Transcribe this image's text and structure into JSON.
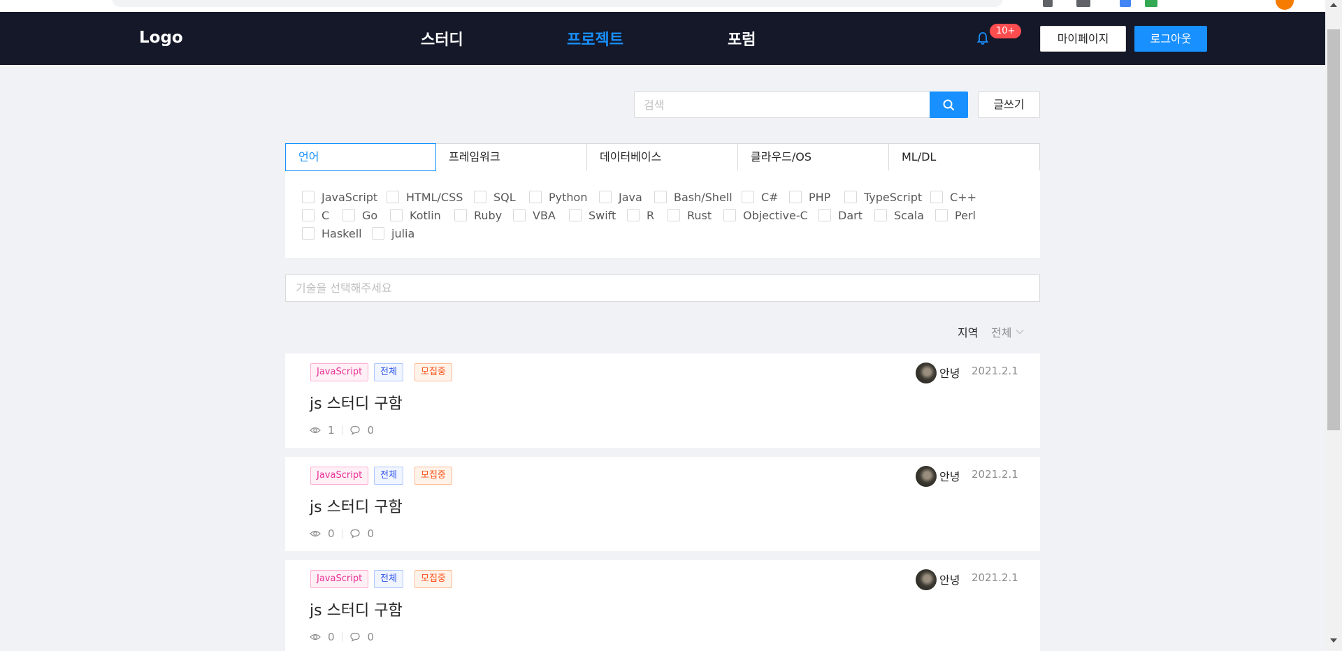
{
  "header": {
    "logo": "Logo",
    "nav": [
      "스터디",
      "프로젝트",
      "포럼"
    ],
    "active_nav": "프로젝트",
    "badge": "10+",
    "mypage_label": "마이페이지",
    "logout_label": "로그아웃"
  },
  "search": {
    "placeholder": "검색",
    "write_label": "글쓰기"
  },
  "tabs": [
    "언어",
    "프레임워크",
    "데이터베이스",
    "클라우드/OS",
    "ML/DL"
  ],
  "active_tab": "언어",
  "languages": {
    "row1": [
      "JavaScript",
      "HTML/CSS",
      "SQL",
      "Python",
      "Java",
      "Bash/Shell",
      "C#",
      "PHP",
      "TypeScript",
      "C++"
    ],
    "row2": [
      "C",
      "Go",
      "Kotlin",
      "Ruby",
      "VBA",
      "Swift",
      "R",
      "Rust",
      "Objective-C",
      "Dart",
      "Scala",
      "Perl"
    ],
    "row3": [
      "Haskell",
      "julia"
    ]
  },
  "skill_placeholder": "기술을 선택해주세요",
  "filter": {
    "region_label": "지역",
    "region_value": "전체"
  },
  "posts": [
    {
      "lang": "JavaScript",
      "region": "전체",
      "status": "모집중",
      "title": "js 스터디 구함",
      "views": "1",
      "comments": "0",
      "author": "안녕",
      "date": "2021.2.1"
    },
    {
      "lang": "JavaScript",
      "region": "전체",
      "status": "모집중",
      "title": "js 스터디 구함",
      "views": "0",
      "comments": "0",
      "author": "안녕",
      "date": "2021.2.1"
    },
    {
      "lang": "JavaScript",
      "region": "전체",
      "status": "모집중",
      "title": "js 스터디 구함",
      "views": "0",
      "comments": "0",
      "author": "안녕",
      "date": "2021.2.1"
    }
  ],
  "colors": {
    "header_bg": "#141829",
    "accent": "#1890ff",
    "page_bg": "#f0f2f5",
    "badge": "#ff4d4f"
  }
}
